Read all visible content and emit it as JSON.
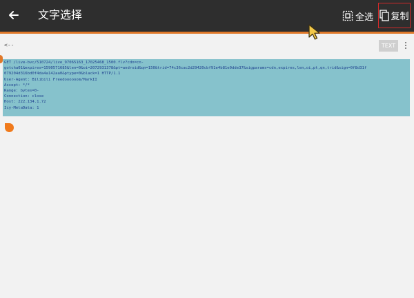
{
  "top_bar": {
    "back_icon": "arrow-left-icon",
    "title": "文字选择",
    "select_all_label": "全选",
    "select_all_icon": "select-all-icon",
    "copy_label": "复制",
    "copy_icon": "copy-icon",
    "background_color": "#2e2e2e",
    "accent_color": "#e0792a",
    "highlight_border_color": "#d42a2a"
  },
  "document": {
    "back_text": "<--",
    "text_toggle_label": "TEXT",
    "more_icon": "more-vertical-icon",
    "selection_color": "#86c2cc",
    "text_color": "#1d3f8e",
    "handle_color": "#f07a1c",
    "request_lines": [
      "GET /live-bvc/510724/live_97065163_17025468_1500.flv?cdn=cn-",
      "gotcha01&expires=1590571685&len=0&oi=2072931378&pt=android&qn=150&trid=74c36cac2d29420cbf91e4b81e0dde37&sigparams=cdn,expires,len,oi,pt,qn,trid&sign=0f8d31f",
      "079204d316bd0f4da4a142aa0&ptype=0&black=1 HTTP/1.1",
      "User-Agent: Bilibili Freedoooooom/MarkII",
      "Accept: */*",
      "Range: bytes=0-",
      "Connection: close",
      "Host: 222.134.1.72",
      "Icy-MetaData: 1"
    ]
  }
}
